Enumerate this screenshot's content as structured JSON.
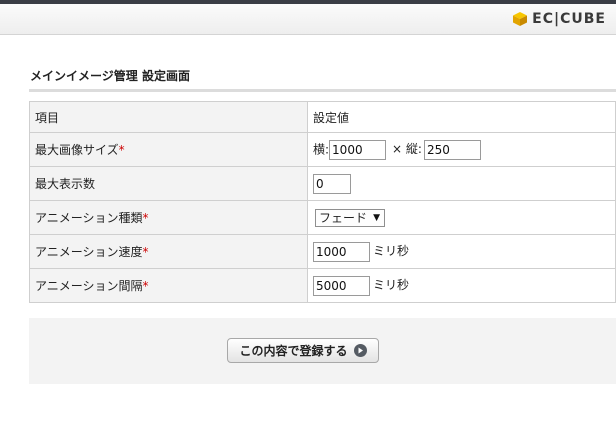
{
  "header": {
    "logo_text": "EC|CUBE",
    "logo_color": "#f0b400"
  },
  "page_title": "メインイメージ管理 設定画面",
  "table": {
    "columns": [
      "項目",
      "設定値"
    ],
    "rows": [
      {
        "label": "最大画像サイズ",
        "required": true
      },
      {
        "label": "最大表示数",
        "required": false
      },
      {
        "label": "アニメーション種類",
        "required": true
      },
      {
        "label": "アニメーション速度",
        "required": true
      },
      {
        "label": "アニメーション間隔",
        "required": true
      }
    ],
    "required_mark": "*"
  },
  "fields": {
    "width_label": "横:",
    "height_sep": "× 縦:",
    "width_value": "1000",
    "height_value": "250",
    "max_display_value": "0",
    "animation_type_value": "フェード",
    "animation_speed_value": "1000",
    "animation_interval_value": "5000",
    "ms_unit": "ミリ秒"
  },
  "footer": {
    "submit_label": "この内容で登録する",
    "submit_icon": "arrow-right-circle-icon"
  }
}
